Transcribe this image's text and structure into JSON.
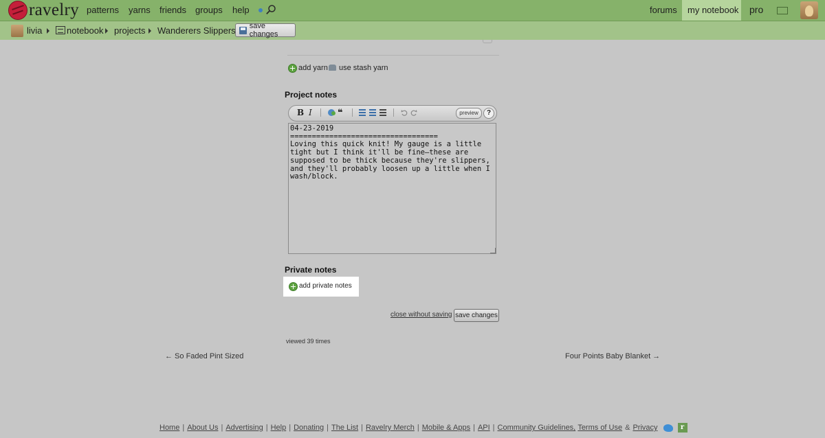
{
  "nav": {
    "logo_text": "ravelry",
    "items": [
      "patterns",
      "yarns",
      "friends",
      "groups",
      "help"
    ],
    "right": {
      "forums": "forums",
      "my_notebook": "my notebook",
      "pro": "pro"
    }
  },
  "breadcrumb": {
    "user": "livia",
    "notebook": "notebook",
    "projects": "projects",
    "project": "Wanderers Slippers",
    "save_label": "save changes"
  },
  "yarn": {
    "add_yarn": "add yarn",
    "use_stash": "use stash yarn"
  },
  "project_notes": {
    "heading": "Project notes",
    "toolbar": {
      "bold": "B",
      "italic": "I",
      "quote": "❝",
      "preview": "preview",
      "help": "?"
    },
    "text": "04-23-2019\n==================================\nLoving this quick knit! My gauge is a little tight but I think it'll be fine—these are supposed to be thick because they're slippers, and they'll probably loosen up a little when I wash/block."
  },
  "private_notes": {
    "heading": "Private notes",
    "add_label": "add private notes"
  },
  "actions": {
    "close_label": "close without saving",
    "save_label": "save changes"
  },
  "viewed": "viewed 39 times",
  "pager": {
    "prev": "← So Faded Pint Sized",
    "next": "Four Points Baby Blanket →"
  },
  "footer": {
    "links": [
      "Home",
      "About Us",
      "Advertising",
      "Help",
      "Donating",
      "The List",
      "Ravelry Merch",
      "Mobile & Apps",
      "API",
      "Community Guidelines,",
      "Terms of Use"
    ],
    "amp": "&",
    "privacy": "Privacy",
    "r_icon": "r"
  }
}
